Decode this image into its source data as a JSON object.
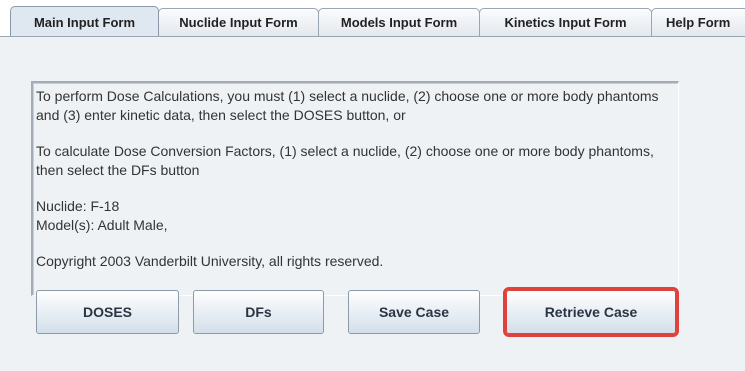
{
  "tabs": [
    {
      "label": "Main Input Form",
      "active": true
    },
    {
      "label": "Nuclide Input Form",
      "active": false
    },
    {
      "label": "Models Input Form",
      "active": false
    },
    {
      "label": "Kinetics Input Form",
      "active": false
    },
    {
      "label": "Help Form",
      "active": false
    }
  ],
  "info": {
    "para1": "To perform Dose Calculations, you must (1) select a nuclide, (2) choose one or more body phantoms and (3) enter kinetic data, then select the DOSES button, or",
    "para2": "To calculate Dose Conversion Factors, (1) select a nuclide, (2) choose one or more body phantoms, then select the DFs button",
    "nuclide": "Nuclide: F-18",
    "models": "Model(s): Adult Male,",
    "copyright": "Copyright 2003 Vanderbilt University, all rights reserved."
  },
  "buttons": {
    "doses": "DOSES",
    "dfs": "DFs",
    "save": "Save Case",
    "retrieve": "Retrieve Case"
  },
  "highlight_color": "#e0413a"
}
